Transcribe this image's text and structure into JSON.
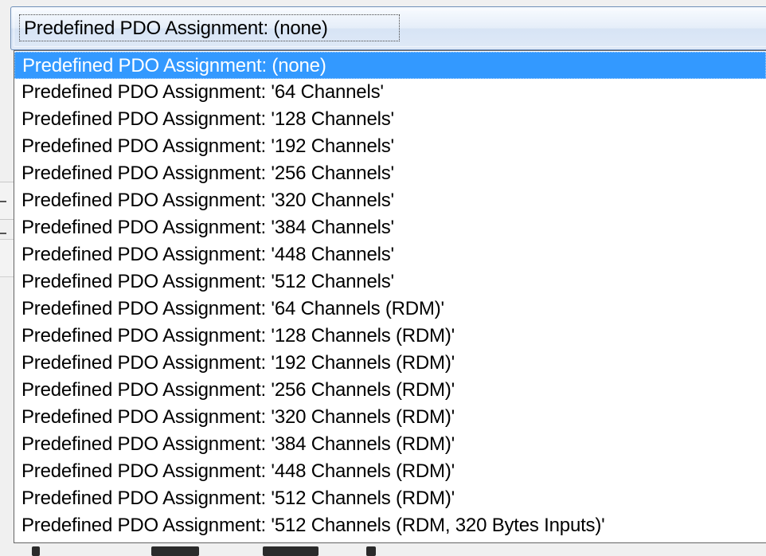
{
  "combobox": {
    "selected_label": "Predefined PDO Assignment: (none)"
  },
  "dropdown": {
    "selected_index": 0,
    "options": [
      "Predefined PDO Assignment: (none)",
      "Predefined PDO Assignment: '64 Channels'",
      "Predefined PDO Assignment: '128 Channels'",
      "Predefined PDO Assignment: '192 Channels'",
      "Predefined PDO Assignment: '256 Channels'",
      "Predefined PDO Assignment: '320 Channels'",
      "Predefined PDO Assignment: '384 Channels'",
      "Predefined PDO Assignment: '448 Channels'",
      "Predefined PDO Assignment: '512 Channels'",
      "Predefined PDO Assignment: '64 Channels (RDM)'",
      "Predefined PDO Assignment: '128 Channels (RDM)'",
      "Predefined PDO Assignment: '192 Channels (RDM)'",
      "Predefined PDO Assignment: '256 Channels (RDM)'",
      "Predefined PDO Assignment: '320 Channels (RDM)'",
      "Predefined PDO Assignment: '384 Channels (RDM)'",
      "Predefined PDO Assignment: '448 Channels (RDM)'",
      "Predefined PDO Assignment: '512 Channels (RDM)'",
      "Predefined PDO Assignment: '512 Channels (RDM, 320 Bytes Inputs)'"
    ]
  },
  "colors": {
    "highlight": "#3399ff",
    "highlight_text": "#ffffff",
    "list_background": "#ffffff",
    "list_border": "#646464"
  }
}
